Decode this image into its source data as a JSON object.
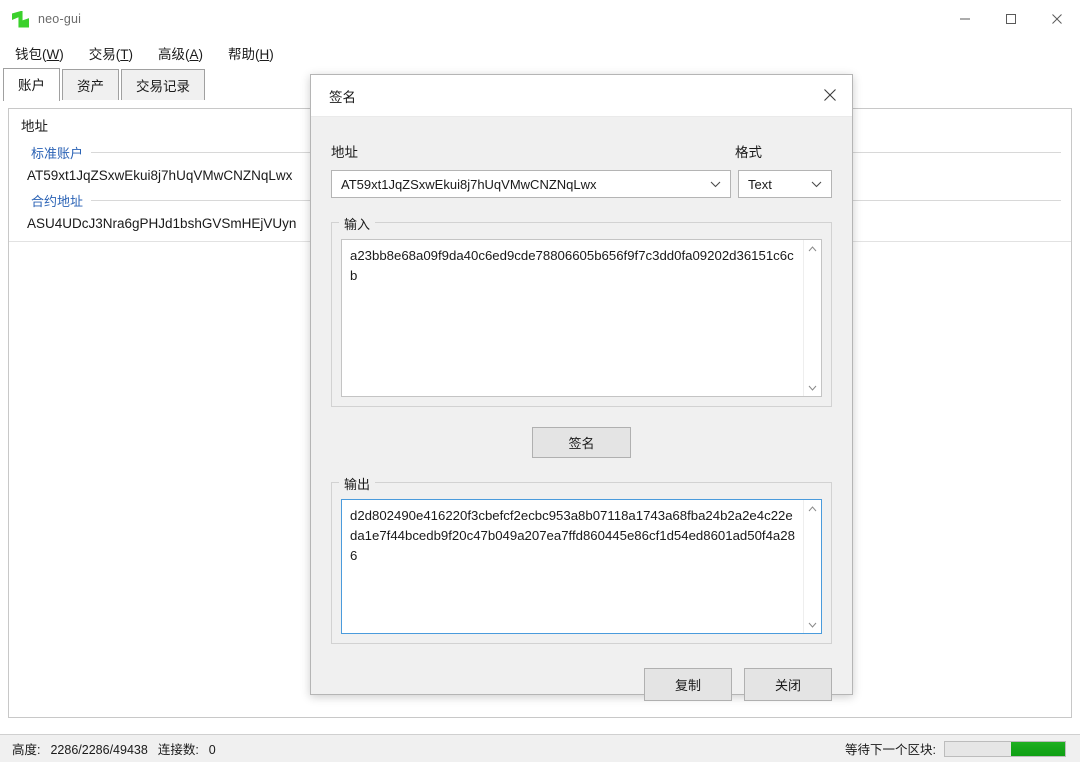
{
  "window": {
    "title": "neo-gui",
    "icon": "neo-logo-icon",
    "minimize_label": "minimize-icon",
    "maximize_label": "maximize-icon",
    "close_label": "close-icon"
  },
  "menubar": {
    "items": [
      {
        "text": "钱包",
        "accel": "W"
      },
      {
        "text": "交易",
        "accel": "T"
      },
      {
        "text": "高级",
        "accel": "A"
      },
      {
        "text": "帮助",
        "accel": "H"
      }
    ]
  },
  "tabs": [
    {
      "label": "账户",
      "active": true
    },
    {
      "label": "资产",
      "active": false
    },
    {
      "label": "交易记录",
      "active": false
    }
  ],
  "account_list": {
    "header": "地址",
    "groups": [
      {
        "label": "标准账户",
        "rows": [
          "AT59xt1JqZSxwEkui8j7hUqVMwCNZNqLwx"
        ]
      },
      {
        "label": "合约地址",
        "rows": [
          "ASU4UDcJ3Nra6gPHJd1bshGVSmHEjVUyn"
        ]
      }
    ]
  },
  "dialog": {
    "title": "签名",
    "close_icon": "close-icon",
    "address_label": "地址",
    "format_label": "格式",
    "address_value": "AT59xt1JqZSxwEkui8j7hUqVMwCNZNqLwx",
    "format_value": "Text",
    "input_group_label": "输入",
    "input_value": "a23bb8e68a09f9da40c6ed9cde78806605b656f9f7c3dd0fa09202d36151c6cb",
    "sign_button": "签名",
    "output_group_label": "输出",
    "output_value": "d2d802490e416220f3cbefcf2ecbc953a8b07118a1743a68fba24b2a2e4c22eda1e7f44bcedb9f20c47b049a207ea7ffd860445e86cf1d54ed8601ad50f4a286",
    "copy_button": "复制",
    "close_button": "关闭"
  },
  "statusbar": {
    "height_label": "高度:",
    "height_value": "2286/2286/49438",
    "peers_label": "连接数:",
    "peers_value": "0",
    "sync_label": "等待下一个区块:",
    "progress_color": "#15a61a",
    "progress_percent": 45
  }
}
